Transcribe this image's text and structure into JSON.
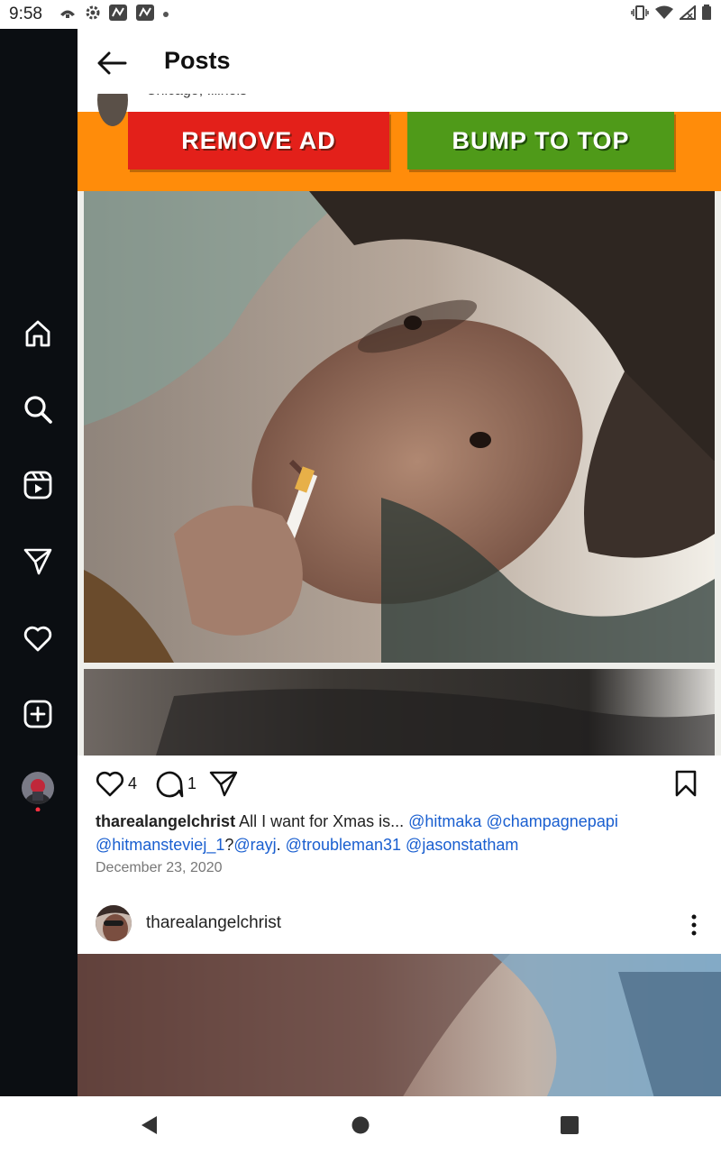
{
  "status_bar": {
    "time": "9:58",
    "left_icons": [
      "cloud-icon",
      "settings-icon",
      "app-icon",
      "app-icon",
      "dot-icon"
    ],
    "right_icons": [
      "vibrate-icon",
      "wifi-icon",
      "signal-icon",
      "battery-icon"
    ]
  },
  "header": {
    "title": "Posts",
    "location_peek": "Chicago, Illinois"
  },
  "sidebar": {
    "items": [
      {
        "name": "home-icon"
      },
      {
        "name": "search-icon"
      },
      {
        "name": "reels-icon"
      },
      {
        "name": "direct-icon"
      },
      {
        "name": "heart-icon"
      },
      {
        "name": "create-icon"
      },
      {
        "name": "profile-avatar"
      }
    ]
  },
  "ad": {
    "remove_label": "REMOVE AD",
    "bump_label": "BUMP TO TOP",
    "colors": {
      "banner": "#ff8c0a",
      "remove": "#e3201a",
      "bump": "#4f9a19"
    }
  },
  "post": {
    "likes": "4",
    "comments": "1",
    "username": "tharealangelchrist",
    "caption_text": " All I want for Xmas is...",
    "mentions": [
      {
        "text": "@hitmaka"
      },
      {
        "text": "@champagnepapi"
      },
      {
        "text": "@hitmansteviej_1"
      },
      {
        "text": "@rayj"
      },
      {
        "text": "@troubleman31"
      },
      {
        "text": "@jasonstatham"
      }
    ],
    "sep_q": "?",
    "sep_dot": ".",
    "date": "December 23, 2020"
  },
  "post2": {
    "username": "tharealangelchrist"
  },
  "accent_color": "#1a5fd0"
}
